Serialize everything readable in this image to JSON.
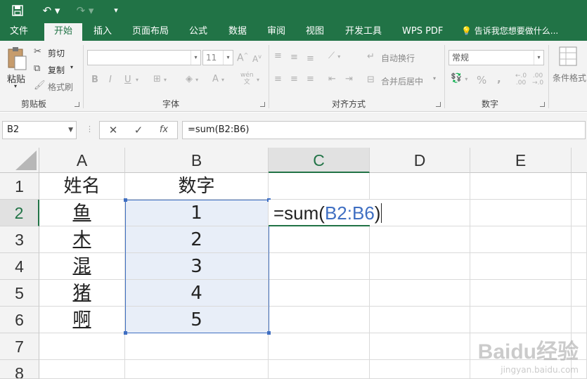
{
  "qat": {
    "save_icon": "save-icon",
    "undo_icon": "undo-icon",
    "redo_icon": "redo-icon",
    "customize_icon": "customize-icon"
  },
  "tabs": [
    {
      "label": "文件"
    },
    {
      "label": "开始"
    },
    {
      "label": "插入"
    },
    {
      "label": "页面布局"
    },
    {
      "label": "公式"
    },
    {
      "label": "数据"
    },
    {
      "label": "审阅"
    },
    {
      "label": "视图"
    },
    {
      "label": "开发工具"
    },
    {
      "label": "WPS PDF"
    }
  ],
  "tell_me": "告诉我您想要做什么...",
  "ribbon": {
    "clipboard": {
      "label": "剪贴板",
      "paste": "粘贴",
      "cut": "剪切",
      "copy": "复制",
      "format_painter": "格式刷"
    },
    "font": {
      "label": "字体",
      "font_size": "11",
      "bold": "B",
      "italic": "I",
      "underline": "U",
      "grow": "A",
      "shrink": "A",
      "color_a": "A",
      "phonetic": "wén"
    },
    "alignment": {
      "label": "对齐方式",
      "wrap_text": "自动换行",
      "merge_center": "合并后居中"
    },
    "number": {
      "label": "数字",
      "format": "常规",
      "percent": "%",
      "comma": ","
    },
    "styles": {
      "conditional": "条件格式"
    }
  },
  "formula_bar": {
    "name_box": "B2",
    "cancel": "✕",
    "enter": "✓",
    "fx": "fx",
    "formula": "=sum(B2:B6)"
  },
  "grid": {
    "columns": [
      "A",
      "B",
      "C",
      "D",
      "E"
    ],
    "rows": [
      "1",
      "2",
      "3",
      "4",
      "5",
      "6",
      "7",
      "8"
    ],
    "cells": [
      [
        "姓名",
        "数字"
      ],
      [
        "鱼",
        "1"
      ],
      [
        "木",
        "2"
      ],
      [
        "混",
        "3"
      ],
      [
        "猪",
        "4"
      ],
      [
        "啊",
        "5"
      ]
    ],
    "editing": {
      "prefix": "=sum(",
      "ref": "B2:B6",
      "suffix": ")"
    },
    "selection_color": "#3f6fc2",
    "active_color": "#217346"
  },
  "watermark": {
    "main": "Baidu经验",
    "sub": "jingyan.baidu.com"
  },
  "theme": {
    "accent": "#217346"
  }
}
